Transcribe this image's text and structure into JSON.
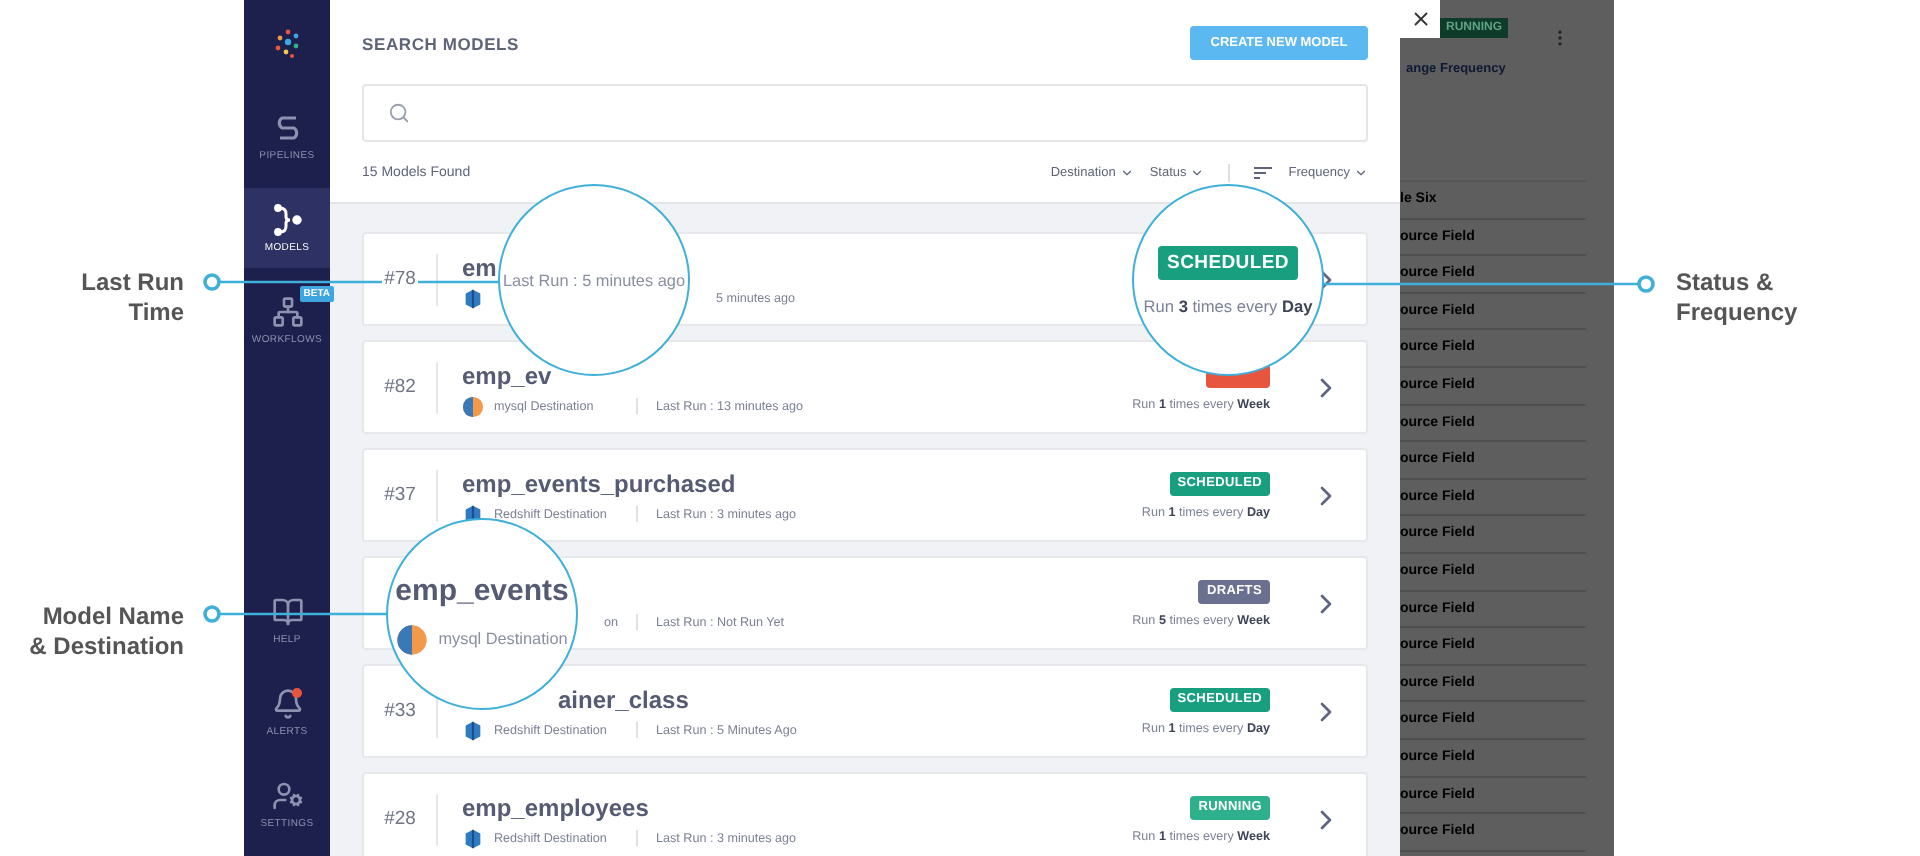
{
  "callouts_left": [
    "Last Run Time",
    "Model Name & Destination"
  ],
  "callouts_right": [
    "Status & Frequency"
  ],
  "sidebar": {
    "top_items": [
      {
        "label": "PIPELINES",
        "selected": false
      },
      {
        "label": "MODELS",
        "selected": true
      },
      {
        "label": "WORKFLOWS",
        "selected": false,
        "badge": "BETA"
      }
    ],
    "bottom_items": [
      {
        "label": "HELP",
        "selected": false,
        "notification": false
      },
      {
        "label": "ALERTS",
        "selected": false,
        "notification": true
      },
      {
        "label": "SETTINGS",
        "selected": false,
        "notification": false
      }
    ]
  },
  "main": {
    "title": "SEARCH MODELS",
    "create_button": "CREATE NEW MODEL",
    "results_count": "15 Models Found",
    "filters": [
      "Destination",
      "Status"
    ],
    "sort": "Frequency"
  },
  "rows": [
    {
      "number": "#78",
      "name": "em",
      "destination": {
        "kind": "redshift"
      },
      "last_run": "5 minutes ago",
      "last_run_cut": true
    },
    {
      "number": "#82",
      "name": "emp_ev",
      "destination": {
        "kind": "mysql",
        "text": "mysql Destination"
      },
      "last_run": "Last Run : 13 minutes ago",
      "status": {
        "color": "#e8553e"
      },
      "run": "Run **1** times every **Week**"
    },
    {
      "number": "#37",
      "name": "emp_events_purchased",
      "destination": {
        "kind": "redshift",
        "text": "Redshift Destination"
      },
      "last_run": "Last Run : 3 minutes ago",
      "status": {
        "text": "SCHEDULED",
        "color": "#179f7f"
      },
      "run": "Run **1** times every **Day**"
    },
    {
      "destination": {
        "text": "on",
        "cut": true
      },
      "last_run": "Last Run : Not Run Yet",
      "status": {
        "text": "DRAFTS",
        "color": "#6a7190"
      },
      "run": "Run **5** times every **Week**"
    },
    {
      "number": "#33",
      "name": "ainer_class",
      "name_cut": true,
      "destination": {
        "kind": "redshift",
        "text": "Redshift Destination"
      },
      "last_run": "Last Run : 5 Minutes Ago",
      "status": {
        "text": "SCHEDULED",
        "color": "#179f7f"
      },
      "run": "Run **1** times every **Day**"
    },
    {
      "number": "#28",
      "name": "emp_employees",
      "destination": {
        "kind": "redshift",
        "text": "Redshift Destination"
      },
      "last_run": "Last Run : 3 minutes ago",
      "status": {
        "text": "RUNNING",
        "color": "#2fb08c"
      },
      "run": "Run **1** times every **Week**"
    }
  ],
  "magnifiers": [
    {
      "kind": "last_run",
      "text": "Last Run : 5 minutes ago"
    },
    {
      "kind": "status",
      "status": {
        "text": "SCHEDULED",
        "color": "#179f7f"
      },
      "run": "Run **3** times every **Day**"
    },
    {
      "kind": "model",
      "name": "emp_events",
      "destination": {
        "kind": "mysql",
        "text": "mysql Destination"
      }
    }
  ],
  "background_panel": {
    "badge": "RUNNING",
    "link": "ange Frequency",
    "rows": [
      "le Six",
      "ource Field",
      "ource Field",
      "ource Field",
      "ource Field",
      "ource Field",
      "ource Field",
      "ource Field",
      "ource Field",
      "ource Field",
      "ource Field",
      "ource Field",
      "ource Field",
      "ource Field",
      "ource Field",
      "ource Field",
      "ource Field",
      "ource Field"
    ]
  }
}
